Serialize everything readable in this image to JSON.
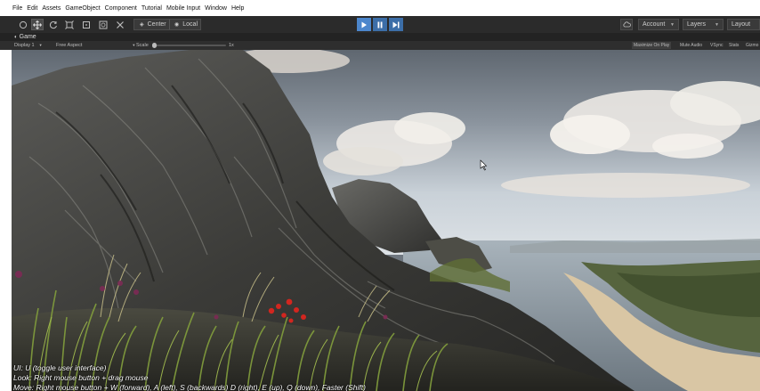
{
  "menu": [
    "File",
    "Edit",
    "Assets",
    "GameObject",
    "Component",
    "Tutorial",
    "Mobile Input",
    "Window",
    "Help"
  ],
  "toolbar": {
    "pivot_label": "Center",
    "rotation_label": "Local",
    "account_label": "Account",
    "layers_label": "Layers",
    "layout_label": "Layout"
  },
  "game_tab": {
    "label": "Game"
  },
  "game_bar": {
    "display": "Display 1",
    "aspect": "Free Aspect",
    "scale_label": "Scale",
    "scale_value": "1x",
    "maximize": "Maximize On Play",
    "mute": "Mute Audio",
    "vsync": "VSync",
    "stats": "Stats",
    "gizmos": "Gizmo"
  },
  "help": {
    "line1": "UI: U (toggle user interface)",
    "line2": "Look: Right mouse button + drag mouse",
    "line3": "Move: Right mouse button + W (forward), A (left), S (backwards) D (right), E (up), Q (down), Faster (Shift)"
  },
  "colors": {
    "editor_dark": "#2b2b2b",
    "play_blue": "#3c6ea8",
    "sky": "#b9c4cf",
    "rock": "#3a3a38",
    "grass": "#6e8a3a",
    "flower": "#c4201f",
    "water": "#8e9aa4"
  },
  "icons": {
    "hand": "hand-icon",
    "move": "move-icon",
    "rotate": "rotate-icon",
    "scale": "scale-icon",
    "rect": "rect-tool-icon",
    "transform": "transform-icon",
    "custom": "custom-tool-icon",
    "play": "play-icon",
    "pause": "pause-icon",
    "step": "step-icon",
    "cloud": "cloud-icon"
  }
}
